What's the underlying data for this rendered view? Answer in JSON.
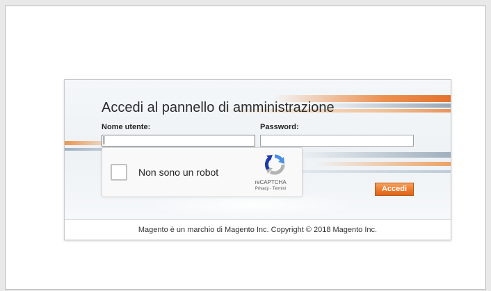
{
  "login": {
    "title": "Accedi al pannello di amministrazione",
    "username_label": "Nome utente:",
    "username_value": "",
    "password_label": "Password:",
    "password_value": "",
    "submit_label": "Accedi"
  },
  "captcha": {
    "label": "Non sono un robot",
    "brand": "reCAPTCHA",
    "privacy": "Privacy",
    "separator": " - ",
    "terms": "Termini",
    "logo_icon": "recaptcha-logo-icon"
  },
  "footer": {
    "text": "Magento è un marchio di Magento Inc. Copyright © 2018 Magento Inc."
  },
  "colors": {
    "accent": "#ec7a2d",
    "recaptcha_blue": "#4a90e2",
    "recaptcha_gray": "#b3b3b3"
  }
}
